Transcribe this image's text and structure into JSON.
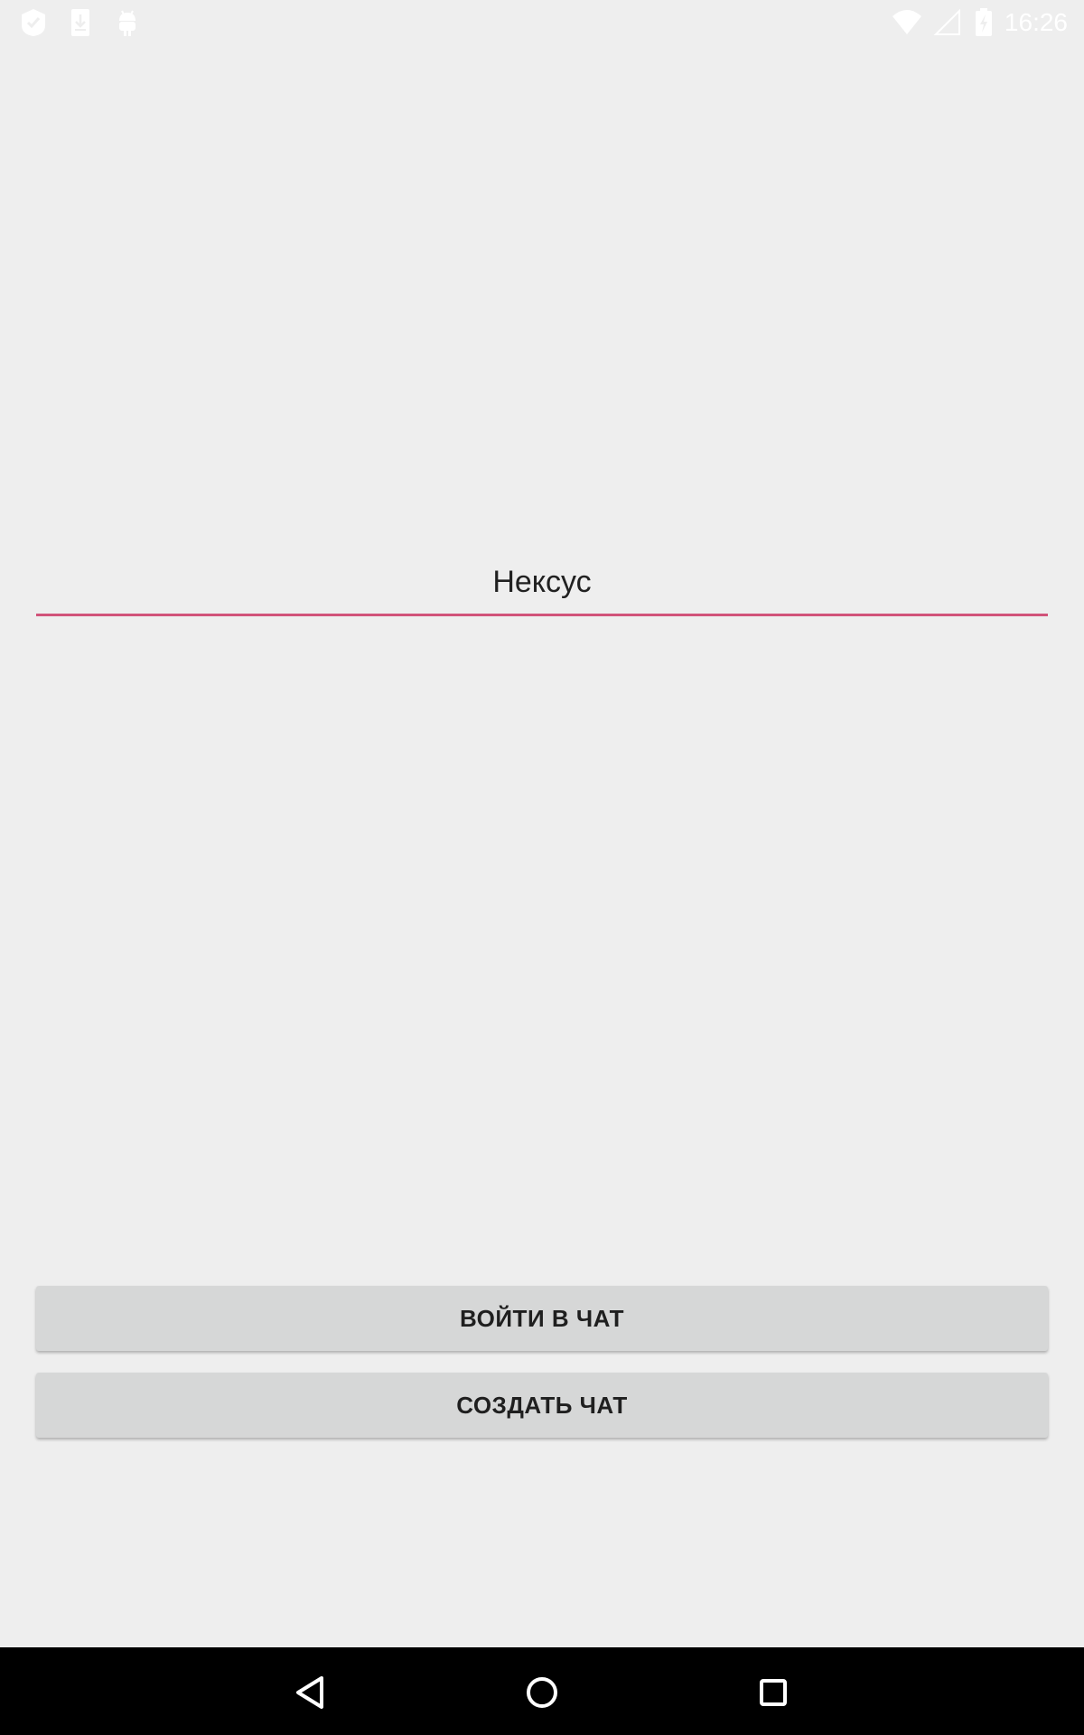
{
  "status_bar": {
    "time": "16:26",
    "left_icons": [
      "check-badge-icon",
      "download-icon",
      "android-icon"
    ],
    "right_icons": [
      "wifi-icon",
      "signal-icon",
      "battery-icon"
    ]
  },
  "form": {
    "chat_name_value": "Нексус",
    "accent_color": "#d1537a"
  },
  "buttons": {
    "join_label": "ВОЙТИ В ЧАТ",
    "create_label": "СОЗДАТЬ ЧАТ"
  },
  "nav_bar": {
    "icons": [
      "back-icon",
      "home-icon",
      "recents-icon"
    ]
  }
}
